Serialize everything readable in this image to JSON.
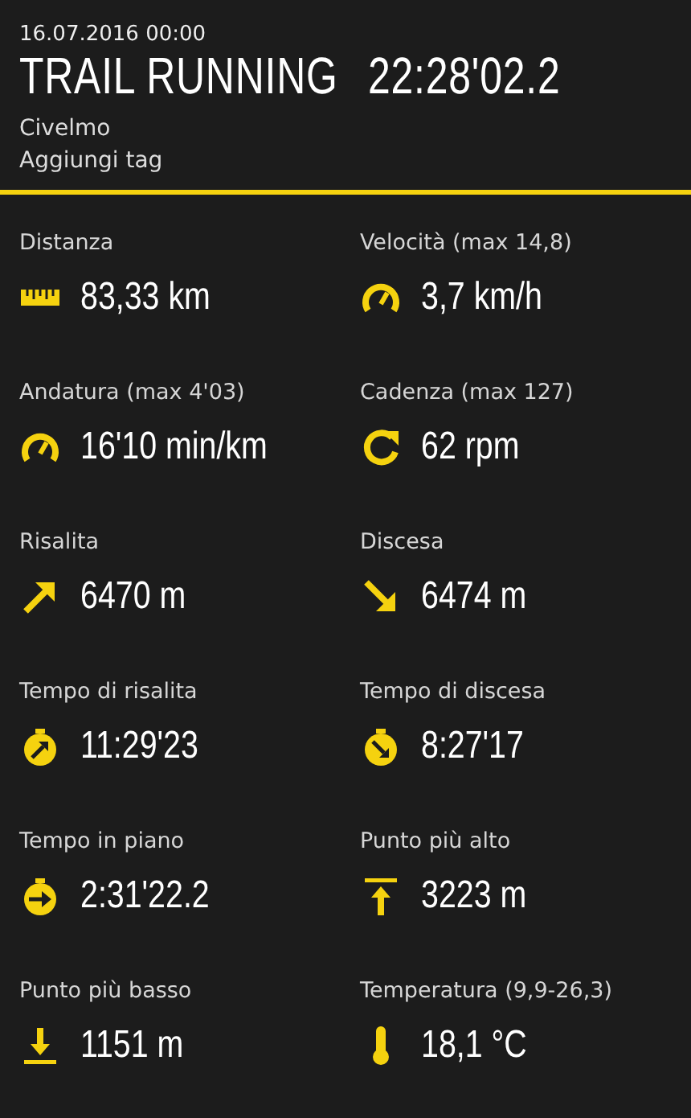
{
  "header": {
    "datetime": "16.07.2016 00:00",
    "activity": "TRAIL RUNNING",
    "duration": "22:28'02.2",
    "location": "Civelmo",
    "tag_link": "Aggiungi tag"
  },
  "stats": [
    {
      "label": "Distanza",
      "value": "83,33 km",
      "kind": "ruler"
    },
    {
      "label": "Velocità (max  14,8)",
      "value": "3,7 km/h",
      "kind": "gauge"
    },
    {
      "label": "Andatura (max  4'03)",
      "value": "16'10 min/km",
      "kind": "gauge"
    },
    {
      "label": "Cadenza (max  127)",
      "value": "62 rpm",
      "kind": "cycle"
    },
    {
      "label": "Risalita",
      "value": "6470 m",
      "kind": "up"
    },
    {
      "label": "Discesa",
      "value": "6474 m",
      "kind": "down"
    },
    {
      "label": "Tempo di risalita",
      "value": "11:29'23",
      "kind": "timer-up"
    },
    {
      "label": "Tempo di discesa",
      "value": "8:27'17",
      "kind": "timer-down"
    },
    {
      "label": "Tempo in piano",
      "value": "2:31'22.2",
      "kind": "timer-flat"
    },
    {
      "label": "Punto più alto",
      "value": "3223 m",
      "kind": "highest"
    },
    {
      "label": "Punto più basso",
      "value": "1151 m",
      "kind": "lowest"
    },
    {
      "label": "Temperatura (9,9-26,3)",
      "value": "18,1 °C",
      "kind": "thermometer"
    }
  ]
}
